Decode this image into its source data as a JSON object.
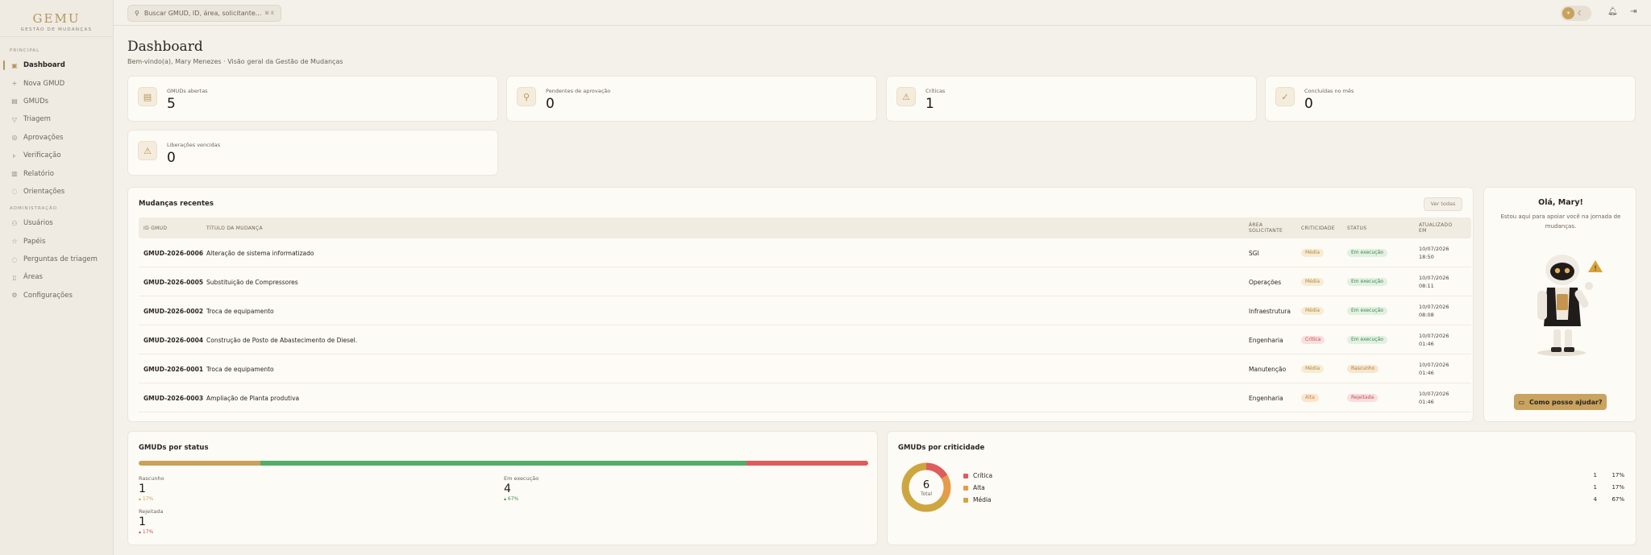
{
  "sidebar": {
    "logo_title": "GEMU",
    "logo_subtitle": "GESTÃO DE MUDANÇAS",
    "section_main": "PRINCIPAL",
    "section_admin": "ADMINISTRAÇÃO",
    "main_items": [
      {
        "label": "Dashboard",
        "icon": "dashboard-icon",
        "glyph": "▣",
        "active": true
      },
      {
        "label": "Nova GMUD",
        "icon": "plus-icon",
        "glyph": "+"
      },
      {
        "label": "GMUDs",
        "icon": "document-icon",
        "glyph": "▤"
      },
      {
        "label": "Triagem",
        "icon": "filter-icon",
        "glyph": "▽"
      },
      {
        "label": "Aprovações",
        "icon": "check-circle-icon",
        "glyph": "◎"
      },
      {
        "label": "Verificação",
        "icon": "user-check-icon",
        "glyph": "ⱶ"
      },
      {
        "label": "Relatório",
        "icon": "report-icon",
        "glyph": "▥"
      },
      {
        "label": "Orientações",
        "icon": "help-circle-icon",
        "glyph": "◌"
      }
    ],
    "admin_items": [
      {
        "label": "Usuários",
        "icon": "users-icon",
        "glyph": "⚇"
      },
      {
        "label": "Papéis",
        "icon": "star-icon",
        "glyph": "☆"
      },
      {
        "label": "Perguntas de triagem",
        "icon": "question-icon",
        "glyph": "◌"
      },
      {
        "label": "Áreas",
        "icon": "building-icon",
        "glyph": "▯"
      },
      {
        "label": "Configurações",
        "icon": "settings-icon",
        "glyph": "⚙"
      }
    ]
  },
  "topbar": {
    "search_placeholder": "Buscar GMUD, ID, área, solicitante...",
    "search_shortcut": "⌘ K"
  },
  "page": {
    "title": "Dashboard",
    "subtitle": "Bem-vindo(a), Mary Menezes · Visão geral da Gestão de Mudanças"
  },
  "stats": [
    {
      "label": "GMUDs abertas",
      "value": "5",
      "icon": "document-icon",
      "glyph": "▤"
    },
    {
      "label": "Pendentes de aprovação",
      "value": "0",
      "icon": "user-icon",
      "glyph": "⚲"
    },
    {
      "label": "Críticas",
      "value": "1",
      "icon": "warning-icon",
      "glyph": "⚠"
    },
    {
      "label": "Concluídas no mês",
      "value": "0",
      "icon": "check-icon",
      "glyph": "✓"
    },
    {
      "label": "Liberações vencidas",
      "value": "0",
      "icon": "warning-icon",
      "glyph": "⚠"
    }
  ],
  "recent": {
    "title": "Mudanças recentes",
    "view_all": "Ver todas",
    "headers": {
      "id": "ID GMUD",
      "title": "TÍTULO DA MUDANÇA",
      "area_1": "ÁREA",
      "area_2": "SOLICITANTE",
      "crit": "CRITICIDADE",
      "status": "STATUS",
      "upd_1": "ATUALIZADO",
      "upd_2": "EM"
    },
    "rows": [
      {
        "id": "GMUD-2026-0006",
        "title": "Alteração de sistema informatizado",
        "area": "SGI",
        "crit": "Média",
        "crit_cls": "b-media",
        "status": "Em execução",
        "status_cls": "b-exec",
        "date": "10/07/2026",
        "time": "18:50"
      },
      {
        "id": "GMUD-2026-0005",
        "title": "Substituição de Compressores",
        "area": "Operações",
        "crit": "Média",
        "crit_cls": "b-media",
        "status": "Em execução",
        "status_cls": "b-exec",
        "date": "10/07/2026",
        "time": "08:11"
      },
      {
        "id": "GMUD-2026-0002",
        "title": "Troca de equipamento",
        "area": "Infraestrutura",
        "crit": "Média",
        "crit_cls": "b-media",
        "status": "Em execução",
        "status_cls": "b-exec",
        "date": "10/07/2026",
        "time": "08:08"
      },
      {
        "id": "GMUD-2026-0004",
        "title": "Construção de Posto de Abastecimento de Diesel.",
        "area": "Engenharia",
        "crit": "Crítica",
        "crit_cls": "b-critica",
        "status": "Em execução",
        "status_cls": "b-exec",
        "date": "10/07/2026",
        "time": "01:46"
      },
      {
        "id": "GMUD-2026-0001",
        "title": "Troca de equipamento",
        "area": "Manutenção",
        "crit": "Média",
        "crit_cls": "b-media",
        "status": "Rascunho",
        "status_cls": "b-rasc",
        "date": "10/07/2026",
        "time": "01:46"
      },
      {
        "id": "GMUD-2026-0003",
        "title": "Ampliação de Planta produtiva",
        "area": "Engenharia",
        "crit": "Alta",
        "crit_cls": "b-alta",
        "status": "Rejeitada",
        "status_cls": "b-rej",
        "date": "10/07/2026",
        "time": "01:46"
      }
    ]
  },
  "assistant": {
    "greeting": "Olá, Mary!",
    "line1": "Estou aqui para apoiar você na jornada de",
    "line2": "mudanças.",
    "button": "Como posso ajudar?"
  },
  "by_status": {
    "title": "GMUDs por status",
    "items": [
      {
        "name": "Rascunho",
        "value": 1,
        "pct": "▴ 17%",
        "fraction": 0.1667,
        "color": "#c9a15a",
        "pct_color": "#c9a15a"
      },
      {
        "name": "Em execução",
        "value": 4,
        "pct": "▴ 67%",
        "fraction": 0.6667,
        "color": "#52ad66",
        "pct_color": "#3c8a4c"
      },
      {
        "name": "Rejeitada",
        "value": 1,
        "pct": "▴ 17%",
        "fraction": 0.1667,
        "color": "#df5c5c",
        "pct_color": "#c7504f"
      }
    ]
  },
  "by_crit": {
    "title": "GMUDs por criticidade",
    "total": "6",
    "total_label": "Total",
    "items": [
      {
        "name": "Crítica",
        "count": "1",
        "pct": "17%",
        "fraction": 0.1667,
        "color": "#df5c5c"
      },
      {
        "name": "Alta",
        "count": "1",
        "pct": "17%",
        "fraction": 0.1667,
        "color": "#e79a4a"
      },
      {
        "name": "Média",
        "count": "4",
        "pct": "67%",
        "fraction": 0.6667,
        "color": "#cda640"
      }
    ]
  }
}
